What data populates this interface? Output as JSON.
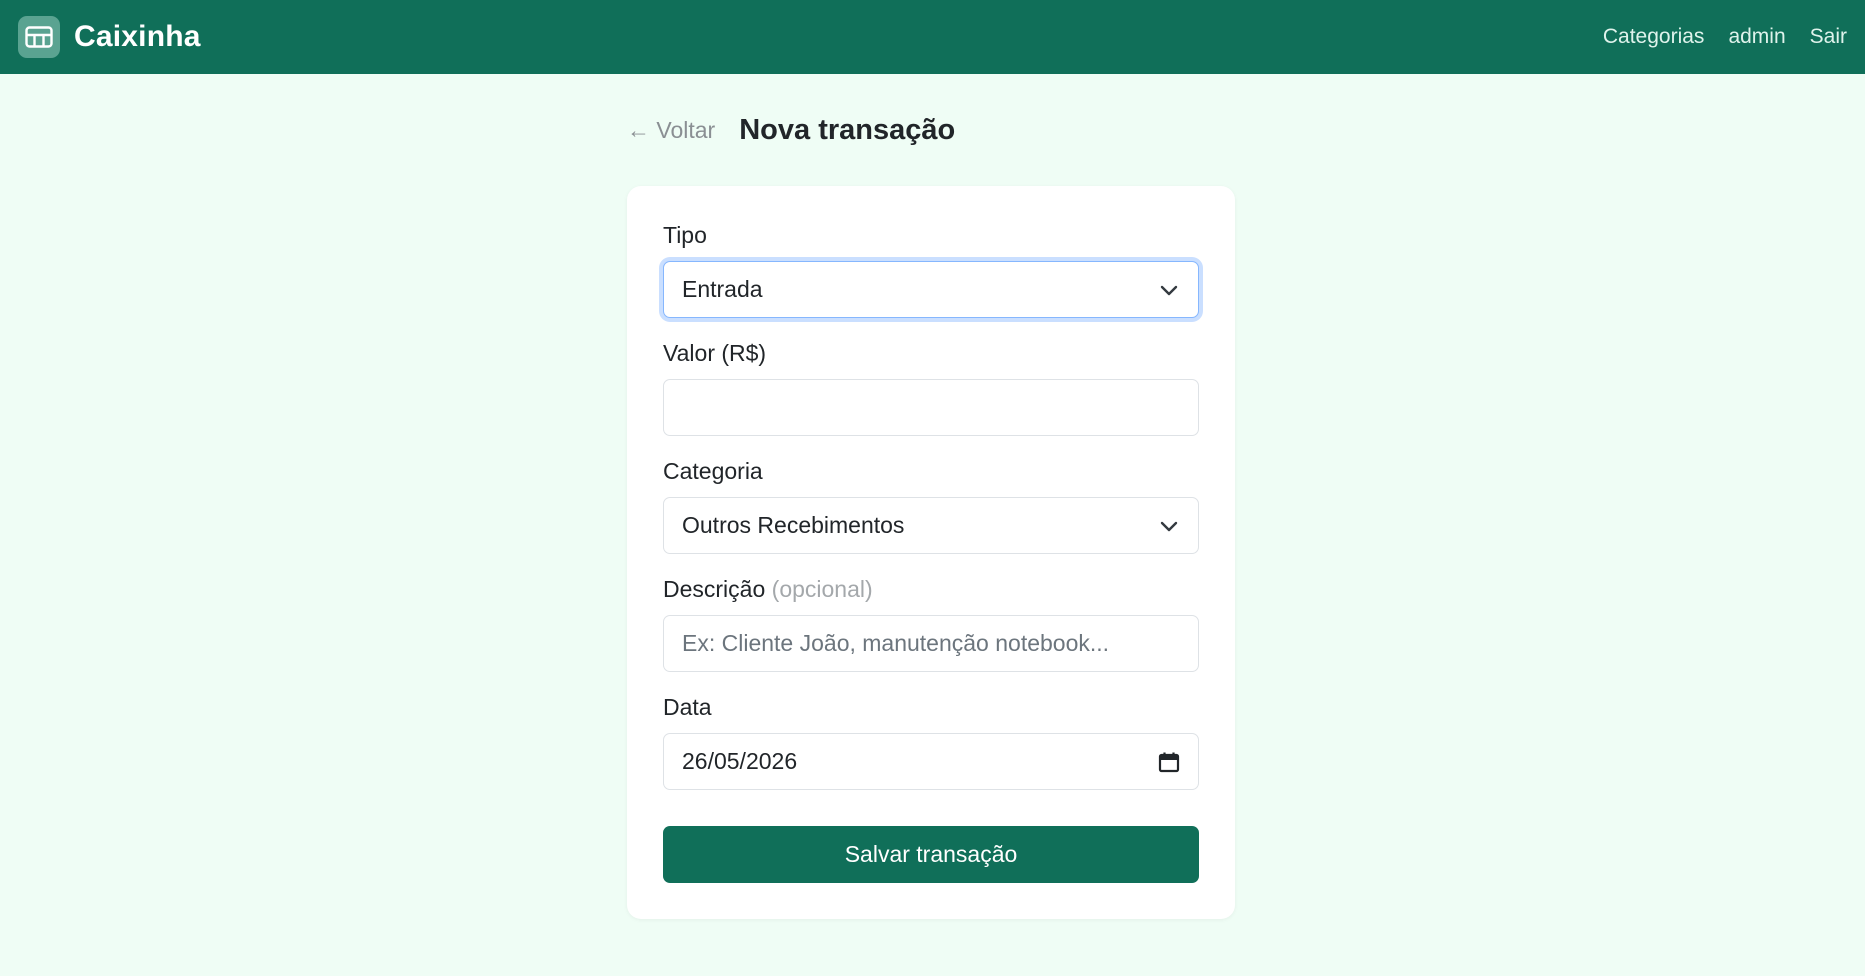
{
  "app": {
    "name": "Caixinha"
  },
  "nav": {
    "categories": "Categorias",
    "user": "admin",
    "logout": "Sair"
  },
  "page": {
    "back": "← Voltar",
    "title": "Nova transação"
  },
  "form": {
    "tipo": {
      "label": "Tipo",
      "value": "Entrada"
    },
    "valor": {
      "label": "Valor (R$)",
      "value": ""
    },
    "categoria": {
      "label": "Categoria",
      "value": "Outros Recebimentos"
    },
    "descricao": {
      "label": "Descrição",
      "optional": "(opcional)",
      "placeholder": "Ex: Cliente João, manutenção notebook..."
    },
    "data": {
      "label": "Data",
      "value": "26/05/2026"
    },
    "submit": "Salvar transação"
  },
  "colors": {
    "primary": "#106f59",
    "background": "#effdf5"
  }
}
